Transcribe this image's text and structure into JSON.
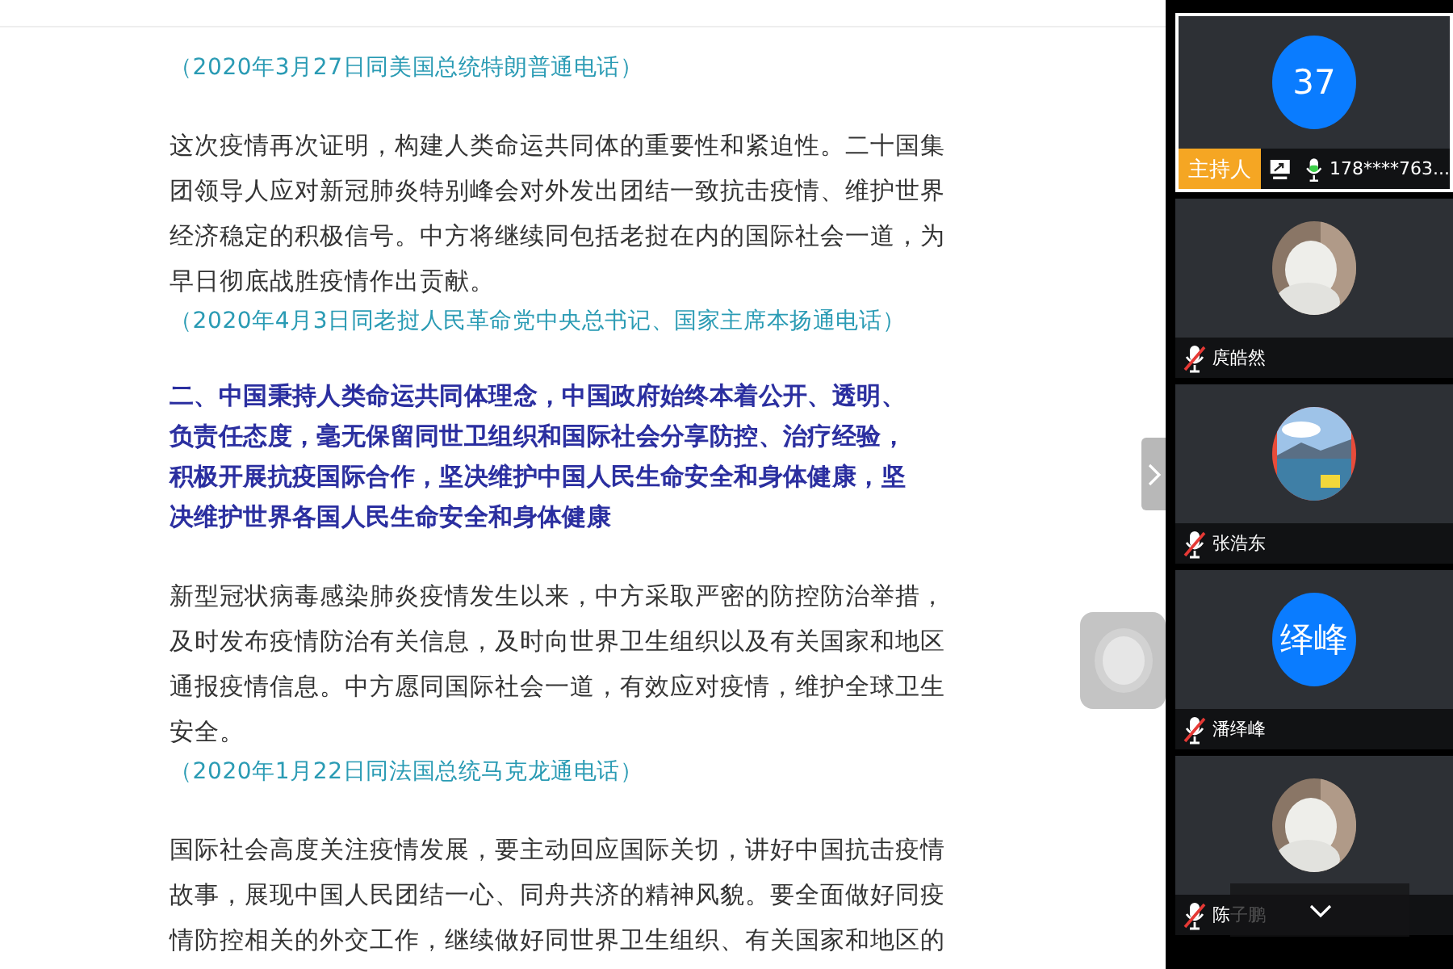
{
  "article": [
    {
      "kind": "citation",
      "text": "（2020年3月27日同美国总统特朗普通电话）"
    },
    {
      "kind": "paragraph",
      "text": "这次疫情再次证明，构建人类命运共同体的重要性和紧迫性。二十国集团领导人应对新冠肺炎特别峰会对外发出团结一致抗击疫情、维护世界经济稳定的积极信号。中方将继续同包括老挝在内的国际社会一道，为早日彻底战胜疫情作出贡献。"
    },
    {
      "kind": "citation",
      "text": "（2020年4月3日同老挝人民革命党中央总书记、国家主席本扬通电话）"
    },
    {
      "kind": "heading",
      "text": "二、中国秉持人类命运共同体理念，中国政府始终本着公开、透明、负责任态度，毫无保留同世卫组织和国际社会分享防控、治疗经验，积极开展抗疫国际合作，坚决维护中国人民生命安全和身体健康，坚决维护世界各国人民生命安全和身体健康"
    },
    {
      "kind": "paragraph",
      "text": "新型冠状病毒感染肺炎疫情发生以来，中方采取严密的防控防治举措，及时发布疫情防治有关信息，及时向世界卫生组织以及有关国家和地区通报疫情信息。中方愿同国际社会一道，有效应对疫情，维护全球卫生安全。"
    },
    {
      "kind": "citation",
      "text": "（2020年1月22日同法国总统马克龙通电话）"
    },
    {
      "kind": "paragraph",
      "text": "国际社会高度关注疫情发展，要主动回应国际关切，讲好中国抗击疫情故事，展现中国人民团结一心、同舟共济的精神风貌。要全面做好同疫情防控相关的外交工作，继续做好同世界卫生组织、有关国家和地区的"
    }
  ],
  "participants": [
    {
      "name": "178****763...",
      "selected": true,
      "muted": false,
      "sharing": true,
      "host_badge": "主持人",
      "avatar": {
        "kind": "text",
        "text": "37"
      }
    },
    {
      "name": "庹皓然",
      "selected": false,
      "muted": true,
      "sharing": false
    },
    {
      "name": "张浩东",
      "selected": false,
      "muted": true,
      "sharing": false
    },
    {
      "name": "潘绎峰",
      "selected": false,
      "muted": true,
      "sharing": false,
      "avatar": {
        "kind": "text",
        "text": "绎峰"
      }
    },
    {
      "name": "陈子鹏",
      "selected": false,
      "muted": true,
      "sharing": false
    }
  ]
}
